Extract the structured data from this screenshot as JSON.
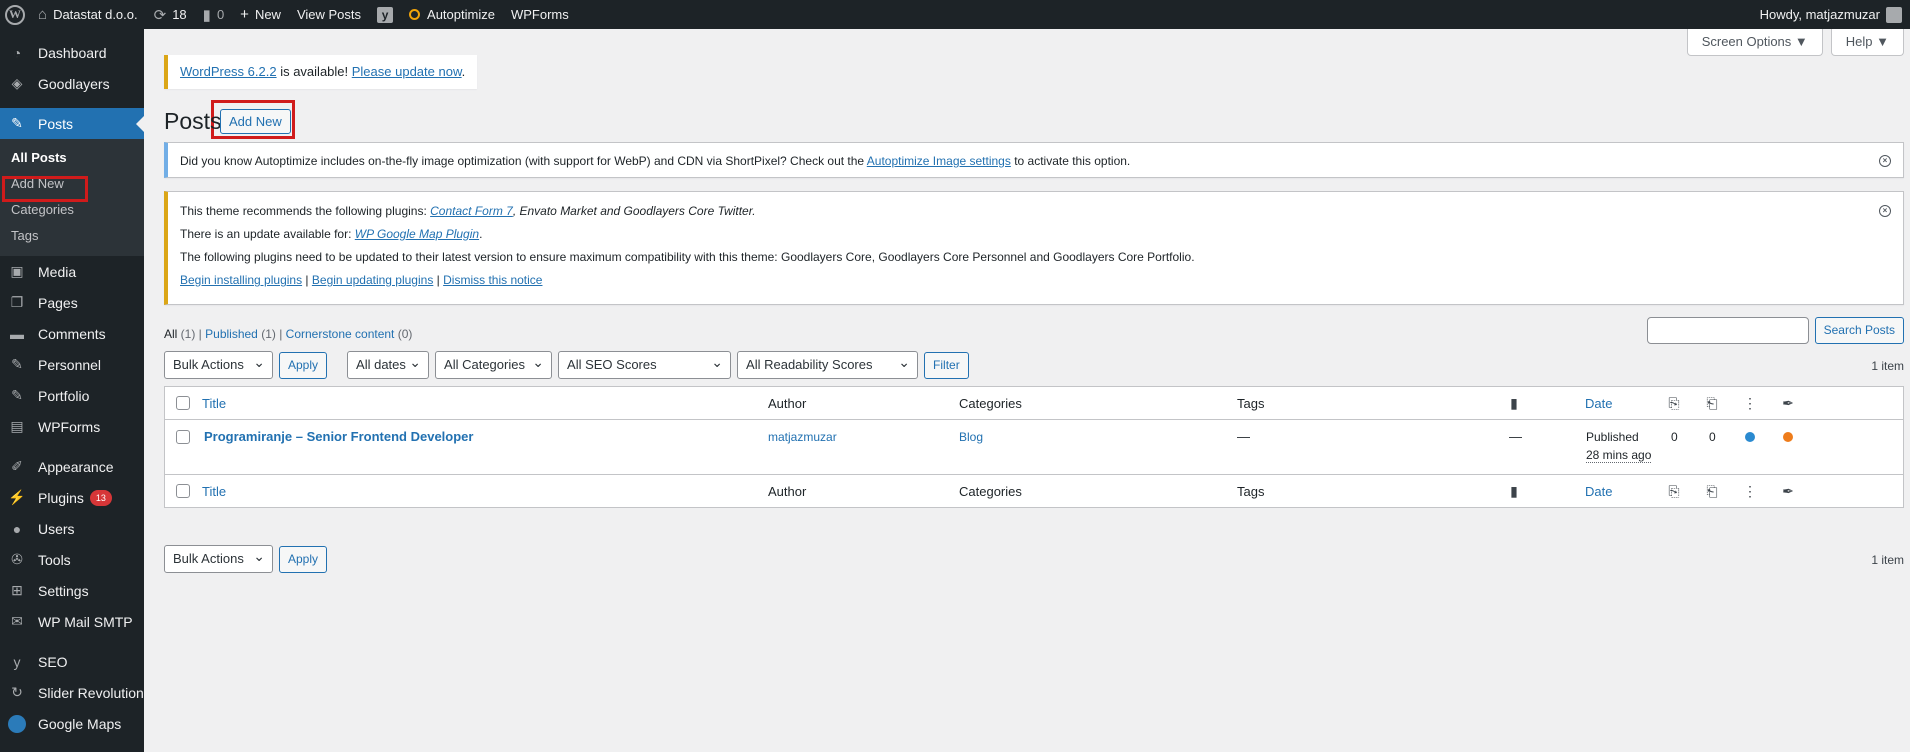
{
  "adminbar": {
    "site_name": "Datastat d.o.o.",
    "updates_count": "18",
    "comments_count": "0",
    "new_label": "New",
    "view_posts_label": "View Posts",
    "autoptimize_label": "Autoptimize",
    "wpforms_label": "WPForms",
    "howdy": "Howdy, matjazmuzar"
  },
  "sidebar": {
    "items": [
      {
        "label": "Dashboard",
        "icon": "dashboard-icon"
      },
      {
        "label": "Goodlayers",
        "icon": "goodlayers-icon"
      },
      {
        "label": "Posts",
        "icon": "pin-icon"
      },
      {
        "label": "Media",
        "icon": "media-icon"
      },
      {
        "label": "Pages",
        "icon": "pages-icon"
      },
      {
        "label": "Comments",
        "icon": "comments-icon"
      },
      {
        "label": "Personnel",
        "icon": "pin-icon"
      },
      {
        "label": "Portfolio",
        "icon": "pin-icon"
      },
      {
        "label": "WPForms",
        "icon": "wpforms-icon"
      },
      {
        "label": "Appearance",
        "icon": "brush-icon"
      },
      {
        "label": "Plugins",
        "icon": "plug-icon",
        "badge": "13"
      },
      {
        "label": "Users",
        "icon": "users-icon"
      },
      {
        "label": "Tools",
        "icon": "wrench-icon"
      },
      {
        "label": "Settings",
        "icon": "settings-icon"
      },
      {
        "label": "WP Mail SMTP",
        "icon": "mail-icon"
      },
      {
        "label": "SEO",
        "icon": "yoast-icon"
      },
      {
        "label": "Slider Revolution",
        "icon": "slider-icon"
      },
      {
        "label": "Google Maps",
        "icon": "google-maps-icon"
      }
    ],
    "posts_submenu": [
      "All Posts",
      "Add New",
      "Categories",
      "Tags"
    ]
  },
  "screen_options": "Screen Options ▼",
  "help": "Help ▼",
  "update_nag": {
    "version_link": "WordPress 6.2.2",
    "middle": " is available! ",
    "update_link": "Please update now",
    "end": "."
  },
  "page": {
    "title": "Posts",
    "add_new": "Add New"
  },
  "notice_autoptimize": {
    "text_before": "Did you know Autoptimize includes on-the-fly image optimization (with support for WebP) and CDN via ShortPixel? Check out the ",
    "link": "Autoptimize Image settings",
    "text_after": " to activate this option."
  },
  "notice_theme": {
    "line1_before": "This theme recommends the following plugins: ",
    "line1_link": "Contact Form 7",
    "line1_after": ", Envato Market and Goodlayers Core Twitter.",
    "line2_before": "There is an update available for: ",
    "line2_link": "WP Google Map Plugin",
    "line2_after": ".",
    "line3": "The following plugins need to be updated to their latest version to ensure maximum compatibility with this theme: Goodlayers Core, Goodlayers Core Personnel and Goodlayers Core Portfolio.",
    "link_install": "Begin installing plugins",
    "link_update": "Begin updating plugins",
    "link_dismiss": "Dismiss this notice",
    "sep": " | "
  },
  "views": {
    "all": "All",
    "all_count": " (1)",
    "published": "Published",
    "published_count": " (1)",
    "cornerstone": "Cornerstone content",
    "cornerstone_count": " (0)",
    "sep": " | "
  },
  "search": {
    "button": "Search Posts",
    "value": ""
  },
  "filters": {
    "bulk_actions": "Bulk Actions",
    "apply": "Apply",
    "dates": "All dates",
    "categories": "All Categories",
    "seo": "All SEO Scores",
    "readability": "All Readability Scores",
    "filter": "Filter",
    "items_count": "1 item"
  },
  "table": {
    "columns": {
      "title": "Title",
      "author": "Author",
      "categories": "Categories",
      "tags": "Tags",
      "date": "Date"
    },
    "rows": [
      {
        "title": "Programiranje – Senior Frontend Developer",
        "author": "matjazmuzar",
        "category": "Blog",
        "tags": "—",
        "comments": "—",
        "status": "Published",
        "date": "28 mins ago",
        "links_out": "0",
        "links_in": "0",
        "seo_color": "#2a8ad0",
        "readability_color": "#ee7c1b"
      }
    ]
  },
  "colors": {
    "admin_bg": "#1d2327",
    "accent": "#2271b1",
    "highlight_box": "#d01b1b"
  }
}
